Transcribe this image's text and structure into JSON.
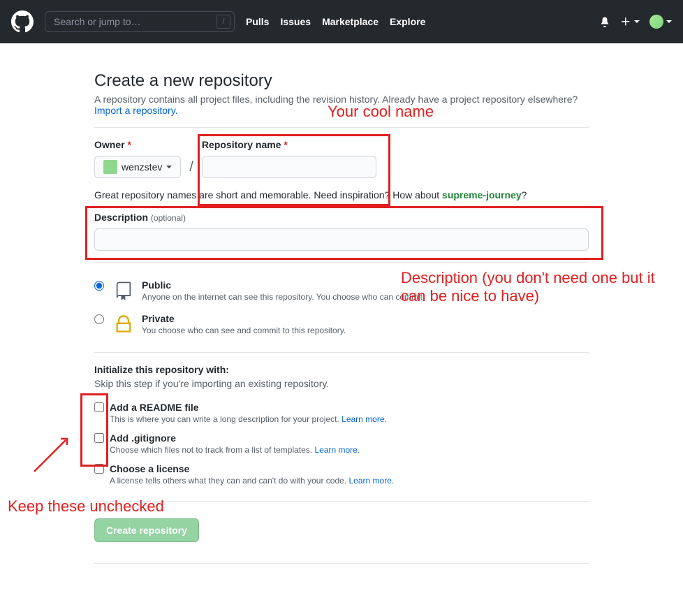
{
  "header": {
    "search_placeholder": "Search or jump to…",
    "nav": [
      "Pulls",
      "Issues",
      "Marketplace",
      "Explore"
    ]
  },
  "page": {
    "title": "Create a new repository",
    "subtitle_prefix": "A repository contains all project files, including the revision history. Already have a project repository elsewhere? ",
    "import_link": "Import a repository."
  },
  "owner": {
    "label": "Owner",
    "value": "wenzstev"
  },
  "repo_name": {
    "label": "Repository name"
  },
  "hint": {
    "prefix": "Great repository names are short and memorable. Need inspiration? How about ",
    "suggestion": "supreme-journey",
    "suffix": "?"
  },
  "description": {
    "label": "Description",
    "optional": "(optional)"
  },
  "visibility": {
    "public": {
      "title": "Public",
      "desc": "Anyone on the internet can see this repository. You choose who can commit."
    },
    "private": {
      "title": "Private",
      "desc": "You choose who can see and commit to this repository."
    }
  },
  "init": {
    "title": "Initialize this repository with:",
    "skip": "Skip this step if you're importing an existing repository.",
    "readme": {
      "title": "Add a README file",
      "desc_prefix": "This is where you can write a long description for your project. ",
      "link": "Learn more."
    },
    "gitignore": {
      "title": "Add .gitignore",
      "desc_prefix": "Choose which files not to track from a list of templates. ",
      "link": "Learn more."
    },
    "license": {
      "title": "Choose a license",
      "desc_prefix": "A license tells others what they can and can't do with your code. ",
      "link": "Learn more."
    }
  },
  "submit_label": "Create repository",
  "annotations": {
    "name": "Your cool name",
    "desc": "Description (you don't need one but it can be nice to have)",
    "unchecked": "Keep these unchecked"
  }
}
